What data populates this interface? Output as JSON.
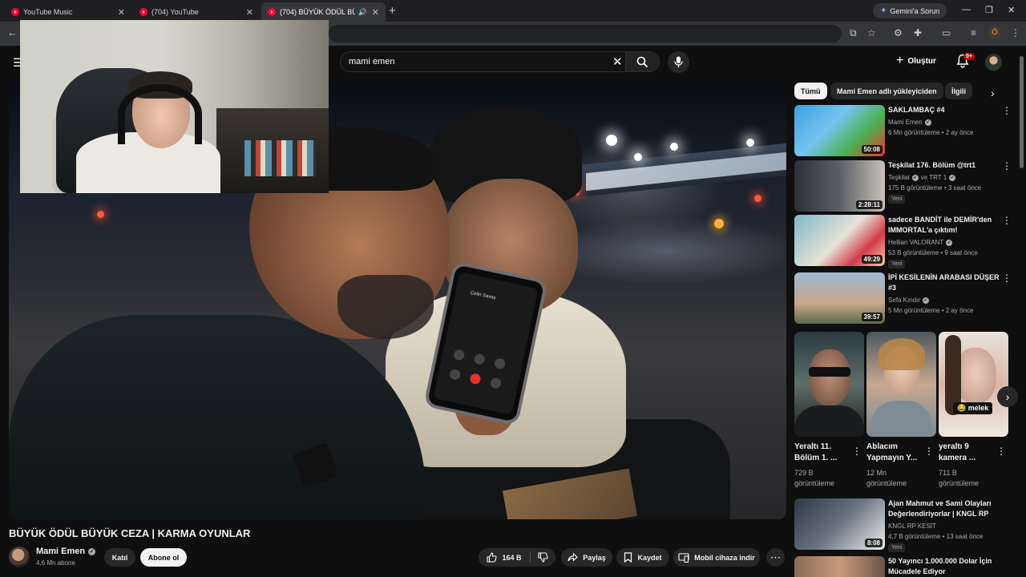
{
  "browser": {
    "tabs": [
      {
        "title": "YouTube Music",
        "active": false
      },
      {
        "title": "(704) YouTube",
        "active": false
      },
      {
        "title": "(704) BÜYÜK ÖDÜL BÜYÜK",
        "active": true
      }
    ],
    "gemini_button": "Gemini'a Sorun",
    "profile_initial": "Ö"
  },
  "masthead": {
    "search_value": "mami emen",
    "create_label": "Oluştur",
    "notification_count": "9+"
  },
  "video": {
    "phone_caller": "Çetin Savaş",
    "title": "BÜYÜK ÖDÜL BÜYÜK CEZA | KARMA OYUNLAR",
    "channel": "Mami Emen",
    "subscribers": "4,6 Mn abone",
    "join_label": "Katıl",
    "subscribe_label": "Abone ol",
    "likes": "164 B",
    "share_label": "Paylaş",
    "save_label": "Kaydet",
    "download_label": "Mobil cihaza indir"
  },
  "sidebar": {
    "chips": [
      "Tümü",
      "Mami Emen adlı yükleyiciden",
      "İlgili"
    ],
    "recommendations": [
      {
        "title": "SAKLAMBAÇ #4",
        "channel": "Mami Emen",
        "views": "6 Mn görüntüleme • 2 ay önce",
        "duration": "50:08"
      },
      {
        "title": "Teşkilat 176. Bölüm @trt1",
        "channel": "Teşkilat",
        "channel_extra": "ve TRT 1",
        "views": "175 B görüntüleme • 3 saat önce",
        "badge": "Yeni",
        "duration": "2:28:11"
      },
      {
        "title": "sadece BANDİT ile DEMİR'den IMMORTAL'a çıktım!",
        "channel": "Hellian VALORANT",
        "views": "53 B görüntüleme • 9 saat önce",
        "badge": "Yeni",
        "duration": "49:29"
      },
      {
        "title": "İPİ KESİLENİN ARABASI DÜŞER #3",
        "channel": "Sefa Kındır",
        "views": "5 Mn görüntüleme • 2 ay önce",
        "duration": "39:57"
      }
    ],
    "shorts": [
      {
        "title": "Yeraltı 11. Bölüm 1. ...",
        "views": "729 B görüntüleme"
      },
      {
        "title": "Ablacım Yapmayın Y...",
        "views": "12 Mn görüntüleme"
      },
      {
        "title": "yeraltı 9 kamera ...",
        "views": "711 B görüntüleme",
        "overlay_label": "😂 melek"
      }
    ],
    "lower_recommendations": [
      {
        "title": "Ajan Mahmut ve Sami Olayları Değerlendiriyorlar | KNGL RP",
        "channel": "KNGL RP KESİT",
        "views": "4,7 B görüntüleme • 13 saat önce",
        "badge": "Yeni",
        "duration": "8:08"
      },
      {
        "title": "50 Yayıncı 1.000.000 Dolar İçin Mücadele Ediyor"
      }
    ]
  },
  "colors": {
    "youtube_red": "#ff0033",
    "badge_red": "#cc0000",
    "background": "#0f0f0f",
    "chip_bg": "#272727"
  }
}
